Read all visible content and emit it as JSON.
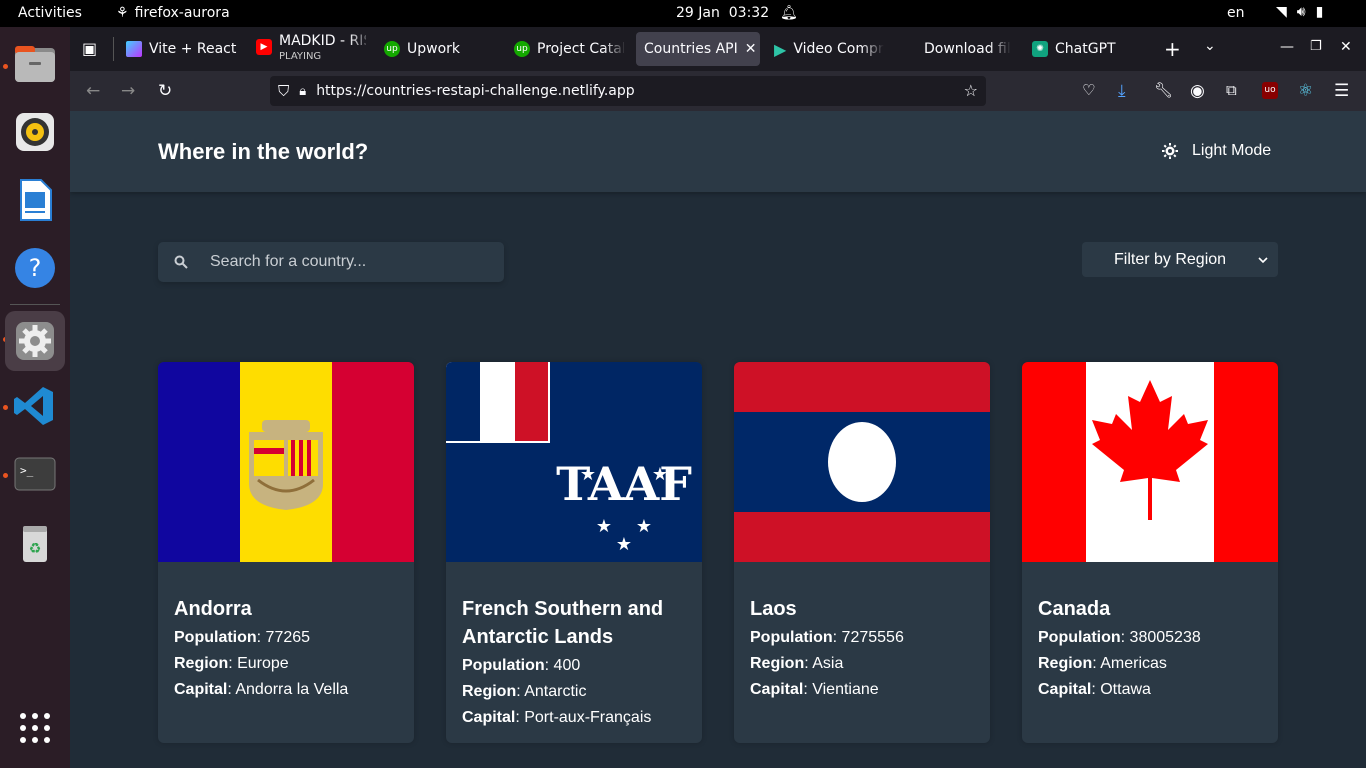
{
  "topbar": {
    "activities": "Activities",
    "app_name": "firefox-aurora",
    "date": "29 Jan",
    "time": "03:32",
    "lang": "en"
  },
  "tabs": [
    {
      "label": "Vite + React"
    },
    {
      "label": "MADKID - RIS",
      "sub": "PLAYING"
    },
    {
      "label": "Upwork"
    },
    {
      "label": "Project Catal"
    },
    {
      "label": "Countries API"
    },
    {
      "label": "Video Compr"
    },
    {
      "label": "Download fil"
    },
    {
      "label": "ChatGPT"
    }
  ],
  "url": "https://countries-restapi-challenge.netlify.app",
  "header": {
    "title": "Where in the world?",
    "mode_label": "Light Mode"
  },
  "search": {
    "placeholder": "Search for a country..."
  },
  "filter": {
    "label": "Filter by Region"
  },
  "labels": {
    "population": "Population",
    "region": "Region",
    "capital": "Capital"
  },
  "countries": [
    {
      "name": "Andorra",
      "population": "77265",
      "region": "Europe",
      "capital": "Andorra la Vella"
    },
    {
      "name": "French Southern and Antarctic Lands",
      "population": "400",
      "region": "Antarctic",
      "capital": "Port-aux-Français"
    },
    {
      "name": "Laos",
      "population": "7275556",
      "region": "Asia",
      "capital": "Vientiane"
    },
    {
      "name": "Canada",
      "population": "38005238",
      "region": "Americas",
      "capital": "Ottawa"
    }
  ],
  "colors": {
    "page_bg": "#202c37",
    "element_bg": "#2b3945",
    "dock_bg": "#2b1d26",
    "accent": "#e95420"
  }
}
